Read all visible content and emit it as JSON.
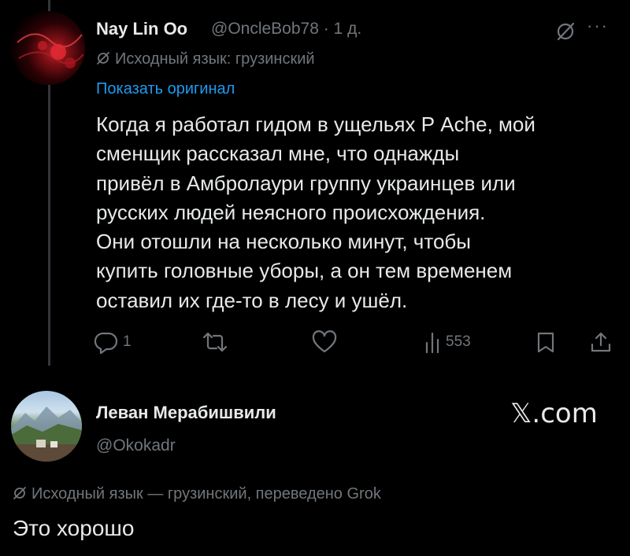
{
  "tweet": {
    "author_name": "Nay Lin Oo",
    "handle_time": "@OncleBob78 · 1 д.",
    "source_language": "Исходный язык: грузинский",
    "show_original_label": "Показать оригинал",
    "text_lines": [
      "Когда я работал гидом в ущельях Р Ache, мой",
      "сменщик рассказал мне, что однажды",
      "привёл в Амбролаури группу украинцев или",
      "русских людей неясного происхождения.",
      "Они отошли на несколько минут, чтобы",
      "купить головные уборы, а он тем временем",
      "оставил их где-то в лесу и ушёл."
    ],
    "actions": {
      "reply_count": "1",
      "retweet_count": "",
      "like_count": "",
      "views_count": "553"
    },
    "icons": {
      "translate": "grok-translate-icon",
      "more": "more-icon",
      "reply": "reply-icon",
      "retweet": "retweet-icon",
      "like": "like-icon",
      "views": "views-icon",
      "bookmark": "bookmark-icon",
      "share": "share-icon"
    }
  },
  "reply": {
    "author_name": "Леван Мерабишвили",
    "handle": "@Okokadr",
    "source_language": "Исходный язык — грузинский, переведено Grok",
    "text": "Это хорошо"
  },
  "watermark": "𝕏.com",
  "colors": {
    "background": "#000000",
    "primary_text": "#e7e9ea",
    "secondary_text": "#71767b",
    "link": "#1d9bf0",
    "thread_line": "#333639"
  }
}
